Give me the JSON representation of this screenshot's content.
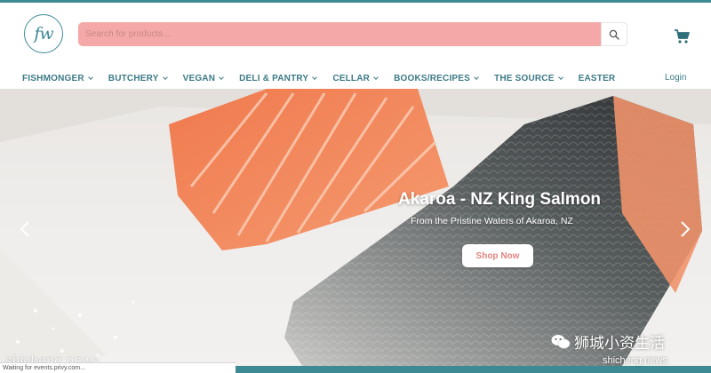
{
  "logo": {
    "text": "fw"
  },
  "search": {
    "placeholder": "Search for products..."
  },
  "nav": {
    "items": [
      {
        "label": "FISHMONGER",
        "has_dropdown": true
      },
      {
        "label": "BUTCHERY",
        "has_dropdown": true
      },
      {
        "label": "VEGAN",
        "has_dropdown": true
      },
      {
        "label": "DELI & PANTRY",
        "has_dropdown": true
      },
      {
        "label": "CELLAR",
        "has_dropdown": true
      },
      {
        "label": "BOOKS/RECIPES",
        "has_dropdown": true
      },
      {
        "label": "THE SOURCE",
        "has_dropdown": true
      },
      {
        "label": "EASTER",
        "has_dropdown": false
      }
    ],
    "login_label": "Login"
  },
  "hero": {
    "title": "Akaroa - NZ King Salmon",
    "subtitle": "From the Pristine Waters of Akaroa, NZ",
    "cta_label": "Shop Now"
  },
  "overlay": {
    "watermark_left": "shicheng.news",
    "status_text": "Waiting for events.privy.com...",
    "watermark_right": "狮城小资生活",
    "watermark_url": "shicheng.news"
  },
  "icons": {
    "search": "search-icon",
    "cart": "cart-icon",
    "prev": "chevron-left-icon",
    "next": "chevron-right-icon",
    "wechat": "wechat-icon"
  },
  "colors": {
    "brand_teal": "#3d8a94",
    "search_bg": "#f4a9a8",
    "cta_text": "#e4837f",
    "nav_text": "#3d7a86"
  }
}
